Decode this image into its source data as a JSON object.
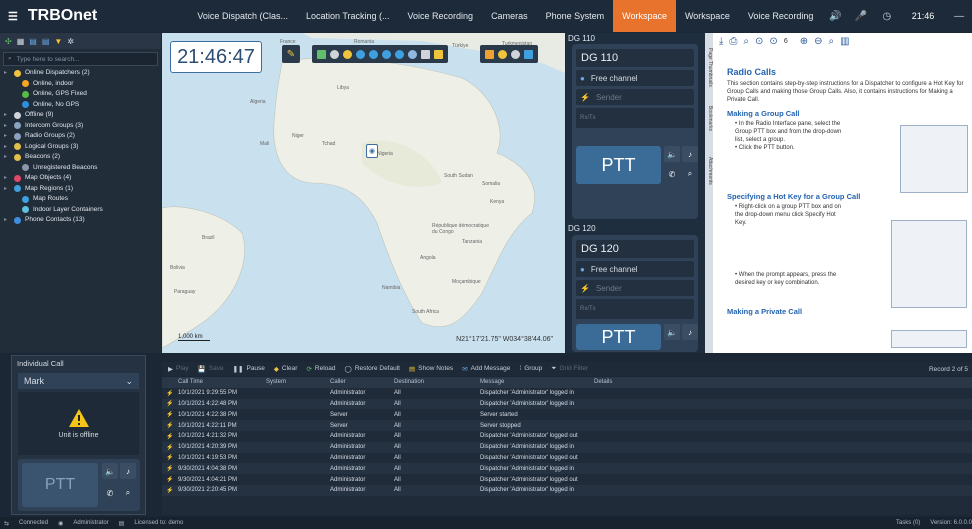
{
  "app": {
    "name": "TRBOnet",
    "time": "21:46"
  },
  "tabs": [
    {
      "label": "Voice Dispatch (Clas..."
    },
    {
      "label": "Location Tracking (..."
    },
    {
      "label": "Voice Recording"
    },
    {
      "label": "Cameras"
    },
    {
      "label": "Phone System"
    },
    {
      "label": "Workspace",
      "active": true
    },
    {
      "label": "Workspace"
    },
    {
      "label": "Voice Recording"
    }
  ],
  "left": {
    "search_placeholder": "Type here to search...",
    "tree": [
      {
        "label": "Online Dispatchers (2)",
        "color": "#f0c33c",
        "indent": 0
      },
      {
        "label": "Online, indoor",
        "color": "#f5a623",
        "indent": 1
      },
      {
        "label": "Online, GPS Fixed",
        "color": "#58b947",
        "indent": 1
      },
      {
        "label": "Online, No GPS",
        "color": "#2d8fe0",
        "indent": 1
      },
      {
        "label": "Offline (9)",
        "color": "#cfd4da",
        "indent": 0
      },
      {
        "label": "Intercom Groups (3)",
        "color": "#8aa3c0",
        "indent": 0
      },
      {
        "label": "Radio Groups (2)",
        "color": "#8aa3c0",
        "indent": 0
      },
      {
        "label": "Logical Groups (3)",
        "color": "#e0c04a",
        "indent": 0
      },
      {
        "label": "Beacons (2)",
        "color": "#e0c04a",
        "indent": 0
      },
      {
        "label": "Unregistered Beacons",
        "color": "#8a98a8",
        "indent": 1
      },
      {
        "label": "Map Objects (4)",
        "color": "#e04a6a",
        "indent": 0
      },
      {
        "label": "Map Regions (1)",
        "color": "#3fa0e0",
        "indent": 0
      },
      {
        "label": "Map Routes",
        "color": "#3fa0e0",
        "indent": 1
      },
      {
        "label": "Indoor Layer Containers",
        "color": "#5fc0e0",
        "indent": 1
      },
      {
        "label": "Phone Contacts (13)",
        "color": "#3f8fe0",
        "indent": 0
      }
    ]
  },
  "map": {
    "clock": "21:46:47",
    "coords": "N21°17'21.75\" W034°38'44.06\"",
    "scale": "1,000 km",
    "labels": [
      "France",
      "Romania",
      "Türkiye",
      "Turkmenistan",
      "Algeria",
      "Mali",
      "Niger",
      "Tchad",
      "Nigeria",
      "South Sudan",
      "Somalia",
      "Kenya",
      "République démocratique du Congo",
      "Tanzania",
      "Angola",
      "Brazil",
      "Bolivia",
      "Paraguay",
      "Namibia",
      "Moçambique",
      "South Africa",
      "Libya"
    ]
  },
  "dg": [
    {
      "head": "DG 110",
      "name": "DG 110",
      "channel": "Free channel",
      "sender": "Sender",
      "rxtx": "Rx/Tx",
      "ptt": "PTT"
    },
    {
      "head": "DG 120",
      "name": "DG 120",
      "channel": "Free channel",
      "sender": "Sender",
      "rxtx": "Rx/Tx",
      "ptt": "PTT"
    }
  ],
  "doc_sidetabs": [
    "Page Thumbnails",
    "Bookmarks",
    "Attachments"
  ],
  "doc": {
    "page": "6",
    "title": "Radio Calls",
    "intro": "This section contains step-by-step instructions for a Dispatcher to configure a Hot Key for Group Calls and making those Group Calls. Also, it contains instructions for Making a Private Call.",
    "s1": "Making a Group Call",
    "s1b1": "In the Radio Interface pane, select the Group PTT box and from the drop-down list, select a group.",
    "s1b2": "Click the PTT button.",
    "s2": "Specifying a Hot Key for a Group Call",
    "s2b1": "Right-click on a group PTT box and on the drop-down menu click Specify Hot Key.",
    "s2b2": "When the prompt appears, press the desired key or key combination.",
    "s3": "Making a Private Call"
  },
  "individual": {
    "title": "Individual Call",
    "name": "Mark",
    "status": "Unit is offline",
    "ptt": "PTT"
  },
  "logbar": [
    "Play",
    "Save",
    "Pause",
    "Clear",
    "Reload",
    "Restore Default",
    "Show Notes",
    "Add Message",
    "Group",
    "Grid Filter"
  ],
  "record": "Record 2 of 5",
  "log_columns": [
    "Call Time",
    "System",
    "Caller",
    "Destination",
    "Message",
    "Details"
  ],
  "log_rows": [
    [
      "10/1/2021 9:29:55 PM",
      "",
      "Administrator",
      "All",
      "Dispatcher 'Administrator' logged in",
      ""
    ],
    [
      "10/1/2021 4:22:48 PM",
      "",
      "Administrator",
      "All",
      "Dispatcher 'Administrator' logged in",
      ""
    ],
    [
      "10/1/2021 4:22:38 PM",
      "",
      "Server",
      "All",
      "Server started",
      ""
    ],
    [
      "10/1/2021 4:22:11 PM",
      "",
      "Server",
      "All",
      "Server stopped",
      ""
    ],
    [
      "10/1/2021 4:21:32 PM",
      "",
      "Administrator",
      "All",
      "Dispatcher 'Administrator' logged out",
      ""
    ],
    [
      "10/1/2021 4:20:39 PM",
      "",
      "Administrator",
      "All",
      "Dispatcher 'Administrator' logged in",
      ""
    ],
    [
      "10/1/2021 4:19:53 PM",
      "",
      "Administrator",
      "All",
      "Dispatcher 'Administrator' logged out",
      ""
    ],
    [
      "9/30/2021 4:04:38 PM",
      "",
      "Administrator",
      "All",
      "Dispatcher 'Administrator' logged in",
      ""
    ],
    [
      "9/30/2021 4:04:21 PM",
      "",
      "Administrator",
      "All",
      "Dispatcher 'Administrator' logged out",
      ""
    ],
    [
      "9/30/2021 2:20:45 PM",
      "",
      "Administrator",
      "All",
      "Dispatcher 'Administrator' logged in",
      ""
    ]
  ],
  "status": {
    "connected": "Connected",
    "user": "Administrator",
    "license": "Licensed to: demo",
    "tasks": "Tasks (0)",
    "version": "Version: 6.0.0.0"
  }
}
